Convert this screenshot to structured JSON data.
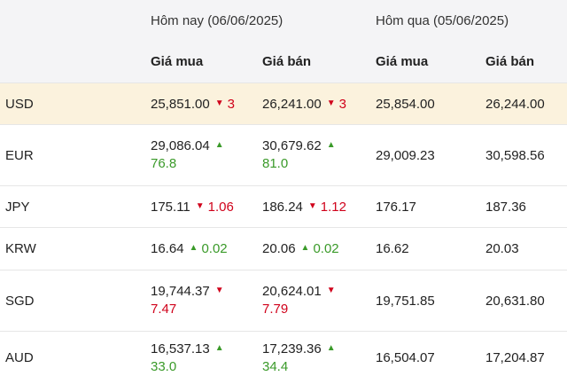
{
  "header": {
    "today": "Hôm nay (06/06/2025)",
    "yesterday": "Hôm qua (05/06/2025)",
    "buy": "Giá mua",
    "sell": "Giá bán"
  },
  "rows": [
    {
      "code": "USD",
      "buy": "25,851.00",
      "buy_dir": "down",
      "buy_chg": "3",
      "sell": "26,241.00",
      "sell_dir": "down",
      "sell_chg": "3",
      "prev_buy": "25,854.00",
      "prev_sell": "26,244.00"
    },
    {
      "code": "EUR",
      "buy": "29,086.04",
      "buy_dir": "up",
      "buy_chg": "76.8",
      "sell": "30,679.62",
      "sell_dir": "up",
      "sell_chg": "81.0",
      "prev_buy": "29,009.23",
      "prev_sell": "30,598.56"
    },
    {
      "code": "JPY",
      "buy": "175.11",
      "buy_dir": "down",
      "buy_chg": "1.06",
      "sell": "186.24",
      "sell_dir": "down",
      "sell_chg": "1.12",
      "prev_buy": "176.17",
      "prev_sell": "187.36"
    },
    {
      "code": "KRW",
      "buy": "16.64",
      "buy_dir": "up",
      "buy_chg": "0.02",
      "sell": "20.06",
      "sell_dir": "up",
      "sell_chg": "0.02",
      "prev_buy": "16.62",
      "prev_sell": "20.03"
    },
    {
      "code": "SGD",
      "buy": "19,744.37",
      "buy_dir": "down",
      "buy_chg": "7.47",
      "sell": "20,624.01",
      "sell_dir": "down",
      "sell_chg": "7.79",
      "prev_buy": "19,751.85",
      "prev_sell": "20,631.80"
    },
    {
      "code": "AUD",
      "buy": "16,537.13",
      "buy_dir": "up",
      "buy_chg": "33.0",
      "sell": "17,239.36",
      "sell_dir": "up",
      "sell_chg": "34.4",
      "prev_buy": "16,504.07",
      "prev_sell": "17,204.87"
    }
  ],
  "icons": {
    "up": "triangle-up-icon",
    "down": "triangle-down-icon"
  },
  "colors": {
    "up": "#3a9a29",
    "down": "#d0021b",
    "highlight_row": "#fbf2dd",
    "header_bg": "#f4f4f6"
  }
}
